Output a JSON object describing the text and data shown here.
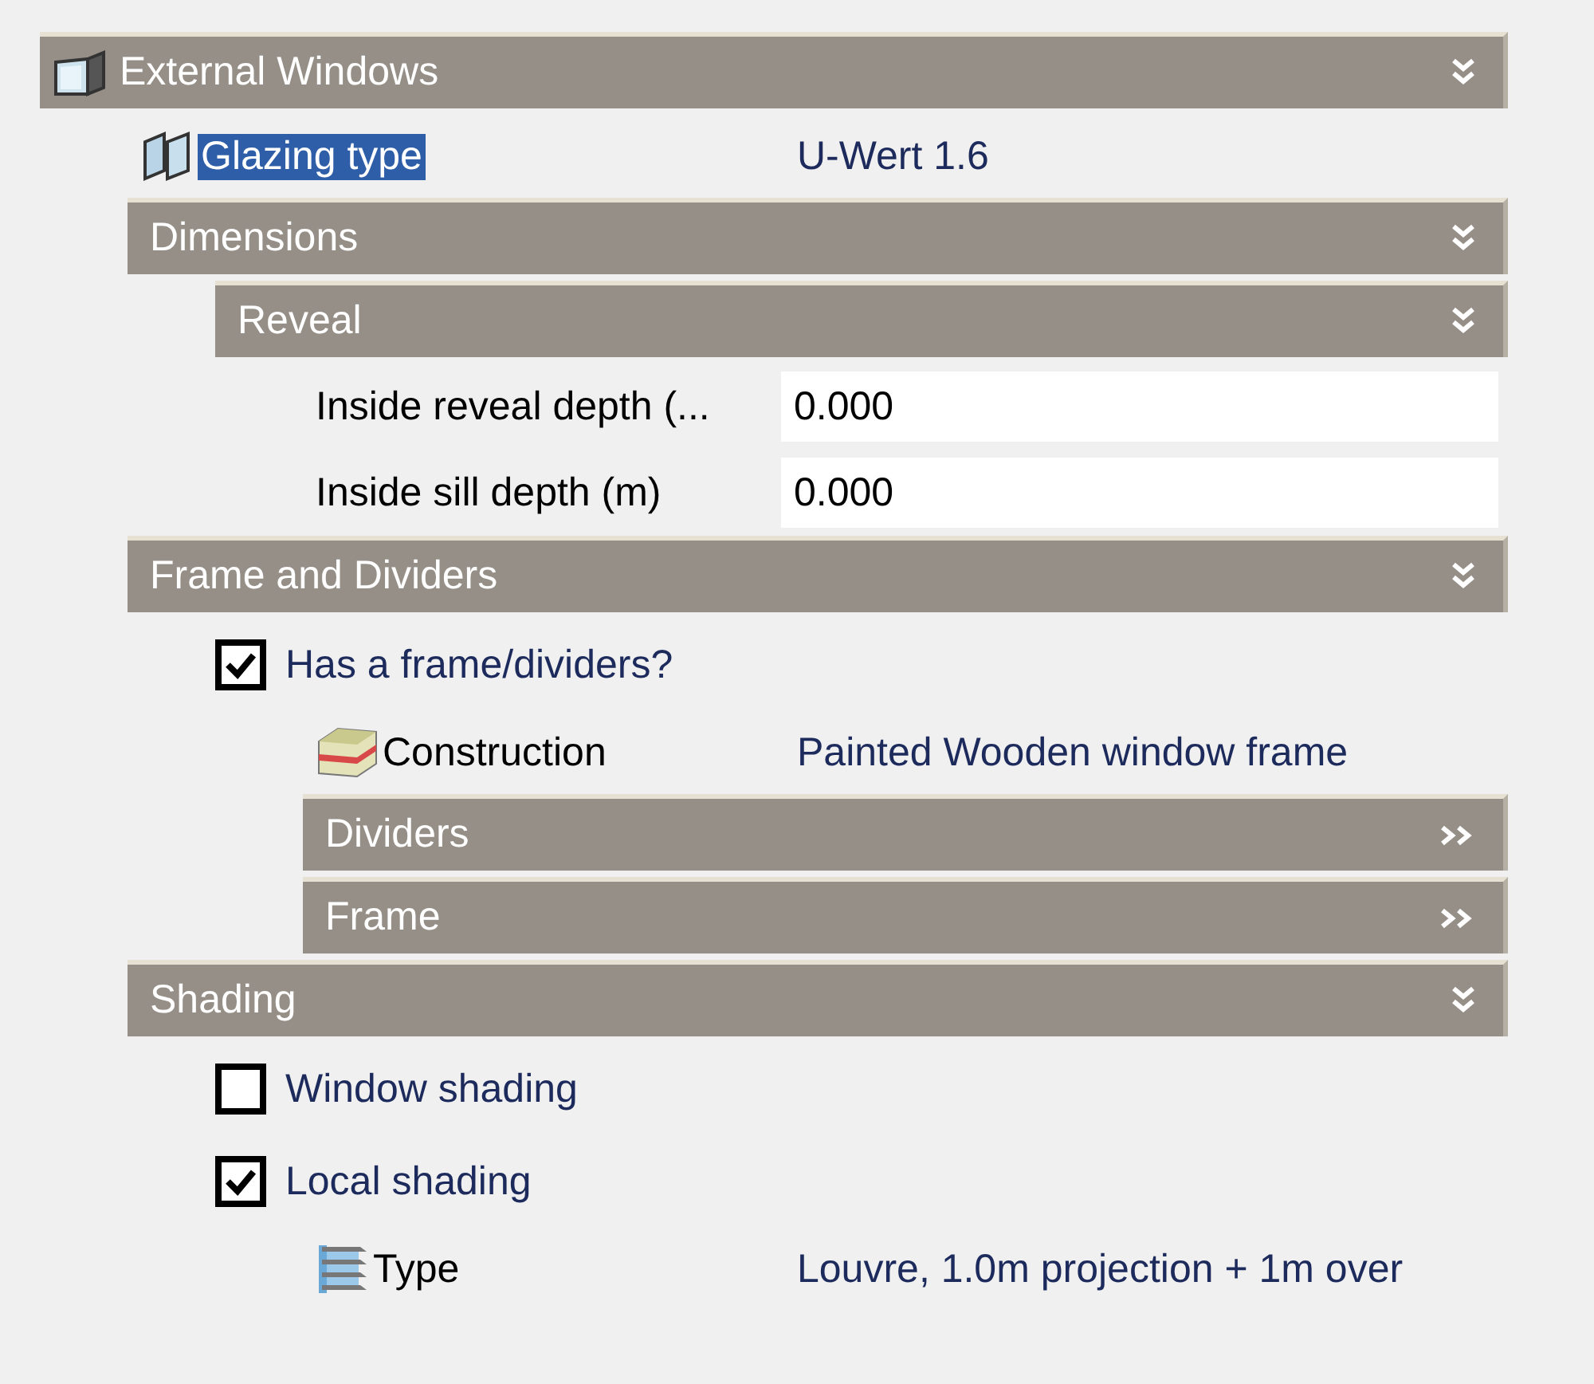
{
  "tree": [
    {
      "kind": "header",
      "label": "External Windows",
      "expanded": true,
      "children": [
        {
          "kind": "property",
          "label": "Glazing type",
          "value": "U-Wert 1.6",
          "selected": true
        },
        {
          "kind": "header",
          "label": "Dimensions",
          "expanded": true,
          "children": [
            {
              "kind": "header",
              "label": "Reveal",
              "expanded": true,
              "children": [
                {
                  "kind": "input",
                  "label": "Inside reveal depth (...",
                  "value": "0.000"
                },
                {
                  "kind": "input",
                  "label": "Inside sill depth (m)",
                  "value": "0.000"
                }
              ]
            }
          ]
        },
        {
          "kind": "header",
          "label": "Frame and Dividers",
          "expanded": true,
          "children": [
            {
              "kind": "checkbox",
              "label": "Has a frame/dividers?",
              "checked": true,
              "children": [
                {
                  "kind": "property",
                  "label": "Construction",
                  "value": "Painted Wooden window frame",
                  "selected": false
                },
                {
                  "kind": "header",
                  "label": "Dividers",
                  "expanded": false
                },
                {
                  "kind": "header",
                  "label": "Frame",
                  "expanded": false
                }
              ]
            }
          ]
        },
        {
          "kind": "header",
          "label": "Shading",
          "expanded": true,
          "children": [
            {
              "kind": "checkbox",
              "label": "Window shading",
              "checked": false
            },
            {
              "kind": "checkbox",
              "label": "Local shading",
              "checked": true,
              "children": [
                {
                  "kind": "property",
                  "label": "Type",
                  "value": "Louvre, 1.0m projection + 1m over",
                  "selected": false
                }
              ]
            }
          ]
        }
      ]
    }
  ]
}
